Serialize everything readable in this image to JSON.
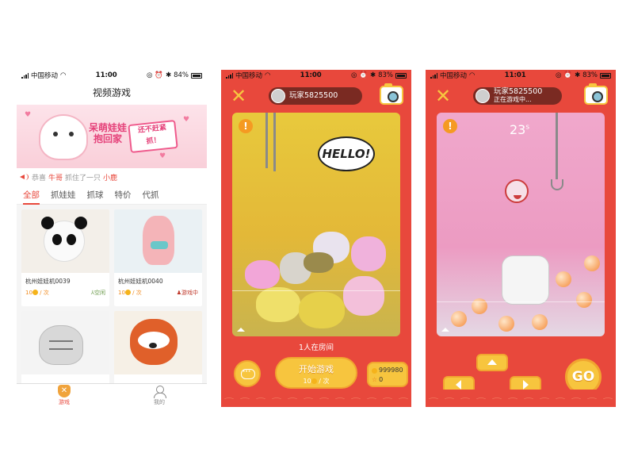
{
  "screen1": {
    "status": {
      "carrier": "中国移动",
      "time": "11:00",
      "battery": "84%"
    },
    "title": "视频游戏",
    "banner": {
      "line1": "呆萌娃娃",
      "line2": "抱回家",
      "line3": "还不赶紧",
      "line4": "抓！"
    },
    "notice": {
      "prefix": "恭喜",
      "user": "牛哥",
      "middle": "抓住了一只",
      "prize": "小鹿"
    },
    "tabs": [
      "全部",
      "抓娃娃",
      "抓球",
      "特价",
      "代抓"
    ],
    "cards": [
      {
        "name": "杭州娃娃机0039",
        "price": "10",
        "unit": "/ 次",
        "status": "空闲"
      },
      {
        "name": "杭州娃娃机0040",
        "price": "10",
        "unit": "/ 次",
        "status": "游戏中"
      },
      {
        "name": "",
        "price": "",
        "unit": "",
        "status": ""
      },
      {
        "name": "",
        "price": "",
        "unit": "",
        "status": ""
      }
    ],
    "nav": [
      {
        "label": "游戏",
        "icon": "game-icon"
      },
      {
        "label": "我的",
        "icon": "profile-icon"
      }
    ]
  },
  "screen2": {
    "status": {
      "carrier": "中国移动",
      "time": "11:00",
      "battery": "83%"
    },
    "player": "玩家5825500",
    "sign": "HELLO!",
    "caption": "1人在房间",
    "start": {
      "label": "开始游戏",
      "cost": "10",
      "unit": "/ 次"
    },
    "coins": {
      "balance": "999980",
      "stars": "0"
    }
  },
  "screen3": {
    "status": {
      "carrier": "中国移动",
      "time": "11:01",
      "battery": "83%"
    },
    "player": "玩家5825500",
    "player_status": "正在游戏中...",
    "timer": "23",
    "timer_unit": "s",
    "go_label": "GO"
  },
  "colors": {
    "accent": "#e8483c",
    "button": "#f7c53e",
    "coin": "#f5b31b"
  }
}
